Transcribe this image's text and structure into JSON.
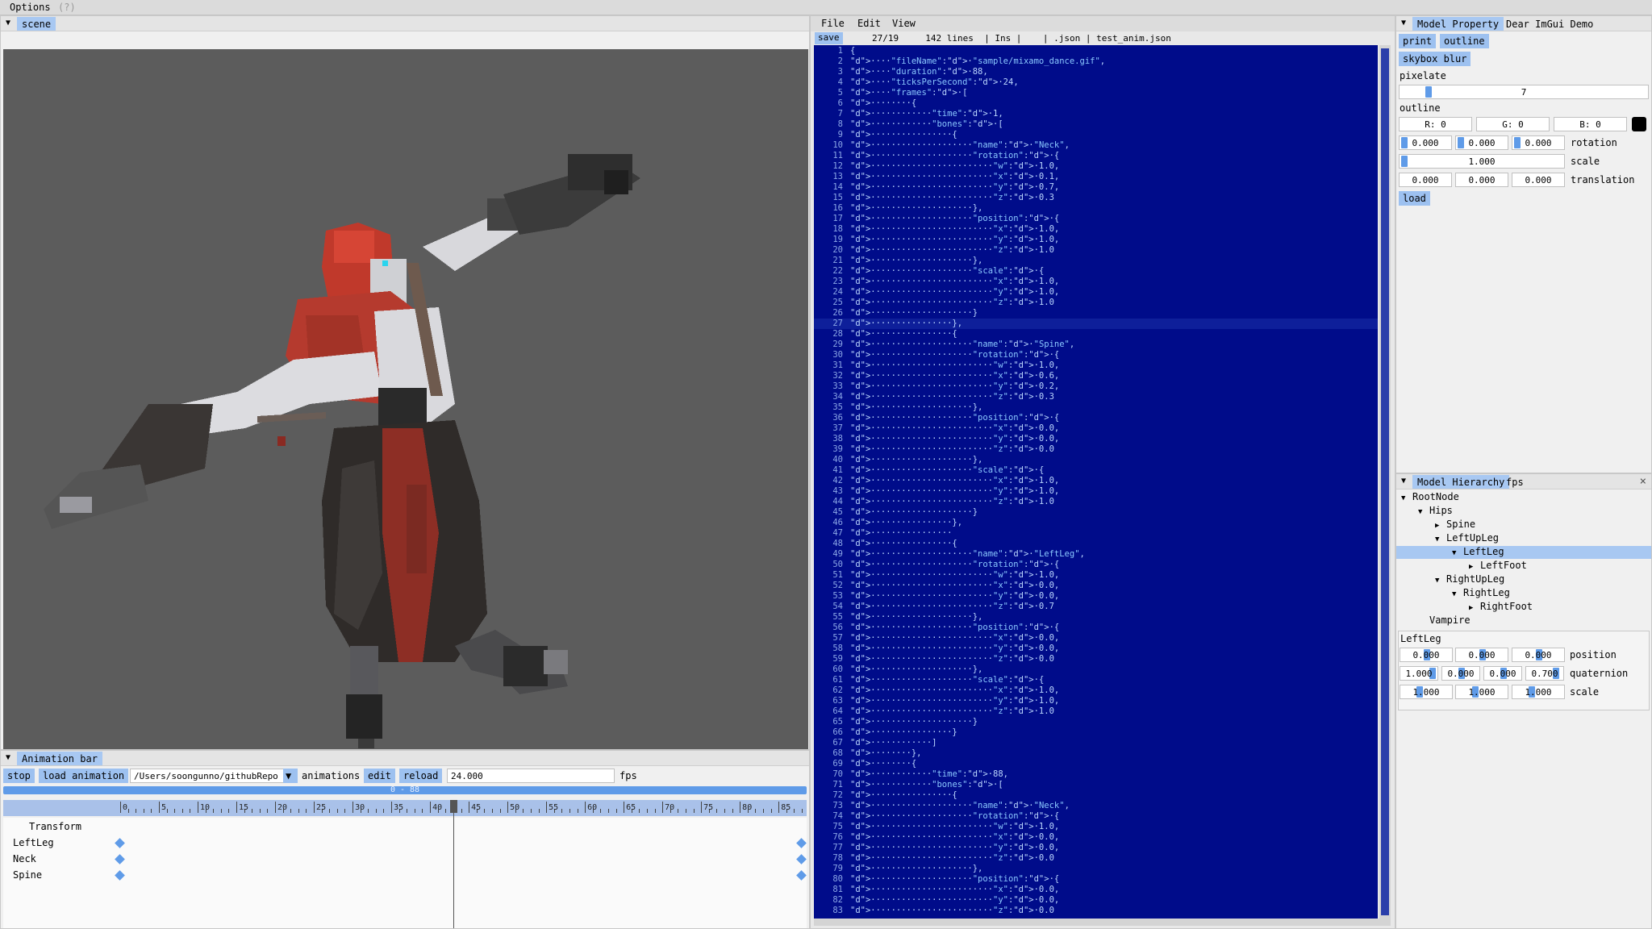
{
  "menubar": {
    "options_label": "Options",
    "help_label": "(?)"
  },
  "scene_window": {
    "tab": "scene"
  },
  "animation_bar": {
    "tab": "Animation bar",
    "stop_label": "stop",
    "load_animation_label": "load animation",
    "path_value": "/Users/soongunno/githubRepo",
    "animations_label": "animations",
    "edit_label": "edit",
    "reload_label": "reload",
    "fps_value": "24.000",
    "fps_label": "fps",
    "range_label": "0 - 88",
    "ruler_ticks": [
      "0",
      "5",
      "10",
      "15",
      "20",
      "25",
      "30",
      "35",
      "40",
      "45",
      "50",
      "55",
      "60",
      "65",
      "70",
      "75",
      "80",
      "85"
    ],
    "current_frame": 43,
    "max_frame": 88,
    "tracks": [
      {
        "name": "Transform",
        "start": null,
        "end": null
      },
      {
        "name": "LeftLeg",
        "start": 0,
        "end": 88
      },
      {
        "name": "Neck",
        "start": 0,
        "end": 88
      },
      {
        "name": "Spine",
        "start": 0,
        "end": 88
      }
    ]
  },
  "text_editor": {
    "menu": [
      "File",
      "Edit",
      "View"
    ],
    "save_label": "save",
    "status": "27/19     142 lines  | Ins |    | .json | test_anim.json",
    "current_line": 27,
    "lines": [
      "{",
      "····\"fileName\":·\"sample/mixamo_dance.gif\",",
      "····\"duration\":·88,",
      "····\"ticksPerSecond\":·24,",
      "····\"frames\":·[",
      "········{",
      "············\"time\":·1,",
      "············\"bones\":·[",
      "················{",
      "····················\"name\":·\"Neck\",",
      "····················\"rotation\":·{",
      "························\"w\":·1.0,",
      "························\"x\":·0.1,",
      "························\"y\":·0.7,",
      "························\"z\":·0.3",
      "····················},",
      "····················\"position\":·{",
      "························\"x\":·1.0,",
      "························\"y\":·1.0,",
      "························\"z\":·1.0",
      "····················},",
      "····················\"scale\":·{",
      "························\"x\":·1.0,",
      "························\"y\":·1.0,",
      "························\"z\":·1.0",
      "····················}",
      "················},",
      "················{",
      "····················\"name\":·\"Spine\",",
      "····················\"rotation\":·{",
      "························\"w\":·1.0,",
      "························\"x\":·0.6,",
      "························\"y\":·0.2,",
      "························\"z\":·0.3",
      "····················},",
      "····················\"position\":·{",
      "························\"x\":·0.0,",
      "························\"y\":·0.0,",
      "························\"z\":·0.0",
      "····················},",
      "····················\"scale\":·{",
      "························\"x\":·1.0,",
      "························\"y\":·1.0,",
      "························\"z\":·1.0",
      "····················}",
      "················},",
      "················",
      "················{",
      "····················\"name\":·\"LeftLeg\",",
      "····················\"rotation\":·{",
      "························\"w\":·1.0,",
      "························\"x\":·0.0,",
      "························\"y\":·0.0,",
      "························\"z\":·0.7",
      "····················},",
      "····················\"position\":·{",
      "························\"x\":·0.0,",
      "························\"y\":·0.0,",
      "························\"z\":·0.0",
      "····················},",
      "····················\"scale\":·{",
      "························\"x\":·1.0,",
      "························\"y\":·1.0,",
      "························\"z\":·1.0",
      "····················}",
      "················}",
      "············]",
      "········},",
      "········{",
      "············\"time\":·88,",
      "············\"bones\":·[",
      "················{",
      "····················\"name\":·\"Neck\",",
      "····················\"rotation\":·{",
      "························\"w\":·1.0,",
      "························\"x\":·0.0,",
      "························\"y\":·0.0,",
      "························\"z\":·0.0",
      "····················},",
      "····················\"position\":·{",
      "························\"x\":·0.0,",
      "························\"y\":·0.0,",
      "························\"z\":·0.0"
    ]
  },
  "model_property": {
    "tabs": [
      "Model Property",
      "Dear ImGui Demo"
    ],
    "print_label": "print",
    "outline_btn_label": "outline",
    "skybox_blur_label": "skybox blur",
    "pixelate_label": "pixelate",
    "pixelate_value": "7",
    "pixelate_fraction": 0.1,
    "outline_label": "outline",
    "outline_rgb": [
      "R:  0",
      "G:  0",
      "B:  0"
    ],
    "outline_color": "#000000",
    "rotation_values": [
      "0.000",
      "0.000",
      "0.000"
    ],
    "rotation_label": "rotation",
    "scale_value": "1.000",
    "scale_label": "scale",
    "translation_values": [
      "0.000",
      "0.000",
      "0.000"
    ],
    "translation_label": "translation",
    "load_label": "load"
  },
  "model_hierarchy": {
    "tabs": [
      "Model Hierarchy",
      "fps"
    ],
    "close_glyph": "×",
    "nodes": [
      {
        "label": "RootNode",
        "depth": 0,
        "arrow": "▼",
        "selected": false
      },
      {
        "label": "Hips",
        "depth": 1,
        "arrow": "▼",
        "selected": false
      },
      {
        "label": "Spine",
        "depth": 2,
        "arrow": "▶",
        "selected": false
      },
      {
        "label": "LeftUpLeg",
        "depth": 2,
        "arrow": "▼",
        "selected": false
      },
      {
        "label": "LeftLeg",
        "depth": 3,
        "arrow": "▼",
        "selected": true
      },
      {
        "label": "LeftFoot",
        "depth": 4,
        "arrow": "▶",
        "selected": false
      },
      {
        "label": "RightUpLeg",
        "depth": 2,
        "arrow": "▼",
        "selected": false
      },
      {
        "label": "RightLeg",
        "depth": 3,
        "arrow": "▼",
        "selected": false
      },
      {
        "label": "RightFoot",
        "depth": 4,
        "arrow": "▶",
        "selected": false
      },
      {
        "label": "Vampire",
        "depth": 1,
        "arrow": "",
        "selected": false
      }
    ],
    "bone_title": "LeftLeg",
    "position_values": [
      "0.000",
      "0.000",
      "0.000"
    ],
    "position_label": "position",
    "quaternion_values": [
      "1.000",
      "0.000",
      "0.000",
      "0.700"
    ],
    "quaternion_label": "quaternion",
    "scale_values": [
      "1.000",
      "1.000",
      "1.000"
    ],
    "scale_label": "scale"
  }
}
